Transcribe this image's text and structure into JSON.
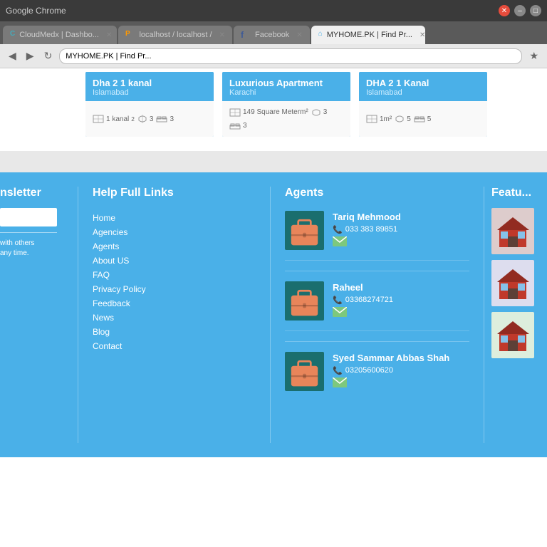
{
  "browser": {
    "title": "Google Chrome",
    "tabs": [
      {
        "id": "cloudmedx",
        "label": "CloudMedx | Dashbo...",
        "active": false,
        "favicon": "C"
      },
      {
        "id": "localhost",
        "label": "localhost / localhost /",
        "active": false,
        "favicon": "P"
      },
      {
        "id": "facebook",
        "label": "Facebook",
        "active": false,
        "favicon": "f"
      },
      {
        "id": "myhome",
        "label": "MYHOME.PK | Find Pr...",
        "active": true,
        "favicon": "M"
      }
    ],
    "url": "MYHOME.PK | Find Pr..."
  },
  "properties": [
    {
      "title": "Dha 2 1 kanal",
      "location": "Islamabad",
      "area": "1 kanal",
      "baths": "3",
      "beds": "3"
    },
    {
      "title": "Luxurious Apartment",
      "location": "Karachi",
      "area": "149 Square Meterm²",
      "baths": "3",
      "beds": "3"
    },
    {
      "title": "DHA 2 1 Kanal",
      "location": "Islamabad",
      "area": "1m²",
      "baths": "5",
      "beds": "5"
    }
  ],
  "newsletter": {
    "title": "nsletter",
    "placeholder": "",
    "description_line1": "with others",
    "description_line2": "any time."
  },
  "help_links": {
    "title": "Help Full Links",
    "links": [
      {
        "label": "Home"
      },
      {
        "label": "Agencies"
      },
      {
        "label": "Agents"
      },
      {
        "label": "About US"
      },
      {
        "label": "FAQ"
      },
      {
        "label": "Privacy Policy"
      },
      {
        "label": "Feedback"
      },
      {
        "label": "News"
      },
      {
        "label": "Blog"
      },
      {
        "label": "Contact"
      }
    ]
  },
  "agents": {
    "title": "Agents",
    "list": [
      {
        "name": "Tariq Mehmood",
        "phone": "033 383 89851"
      },
      {
        "name": "Raheel",
        "phone": "03368274721"
      },
      {
        "name": "Syed Sammar Abbas Shah",
        "phone": "03205600620"
      }
    ]
  },
  "featured": {
    "title": "Featu..."
  }
}
